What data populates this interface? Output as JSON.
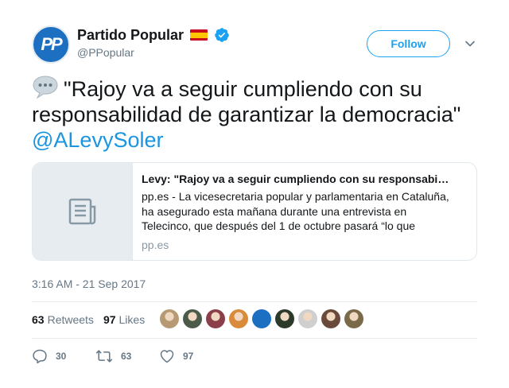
{
  "author": {
    "display_name": "Partido Popular",
    "handle": "@PPopular",
    "avatar_text": "PP"
  },
  "follow_label": "Follow",
  "tweet": {
    "text": "\"Rajoy va a seguir cumpliendo con su responsabilidad de garantizar la democracia\"",
    "mention": "@ALevySoler"
  },
  "card": {
    "title": "Levy: \"Rajoy va a seguir cumpliendo con su responsabilidad de garantizar la democracia\"",
    "description": "pp.es - La vicesecretaria popular y parlamentaria en Cataluña, ha asegurado esta mañana durante una entrevista en Telecinco, que después del 1 de octubre pasará “lo que estamos viendo estos ...",
    "domain": "pp.es"
  },
  "timestamp": "3:16 AM - 21 Sep 2017",
  "stats": {
    "retweets_count": "63",
    "retweets_label": "Retweets",
    "likes_count": "97",
    "likes_label": "Likes"
  },
  "liker_avatars": [
    {
      "name": "liker-avatar-1",
      "color": "#b79a74"
    },
    {
      "name": "liker-avatar-2",
      "color": "#4c5a4a"
    },
    {
      "name": "liker-avatar-3",
      "color": "#8a3f4a"
    },
    {
      "name": "liker-avatar-4",
      "color": "#d98a3a"
    },
    {
      "name": "liker-avatar-5",
      "color": "#1d6fc2"
    },
    {
      "name": "liker-avatar-6",
      "color": "#2c3a2a"
    },
    {
      "name": "liker-avatar-7",
      "color": "#cfcfcf"
    },
    {
      "name": "liker-avatar-8",
      "color": "#6a4a3a"
    },
    {
      "name": "liker-avatar-9",
      "color": "#7a6a4a"
    }
  ],
  "actions": {
    "reply_count": "30",
    "retweet_count": "63",
    "like_count": "97"
  },
  "colors": {
    "accent": "#1da1f2",
    "mention": "#1b95e0",
    "muted": "#657786",
    "brand": "#1d6fc2"
  }
}
